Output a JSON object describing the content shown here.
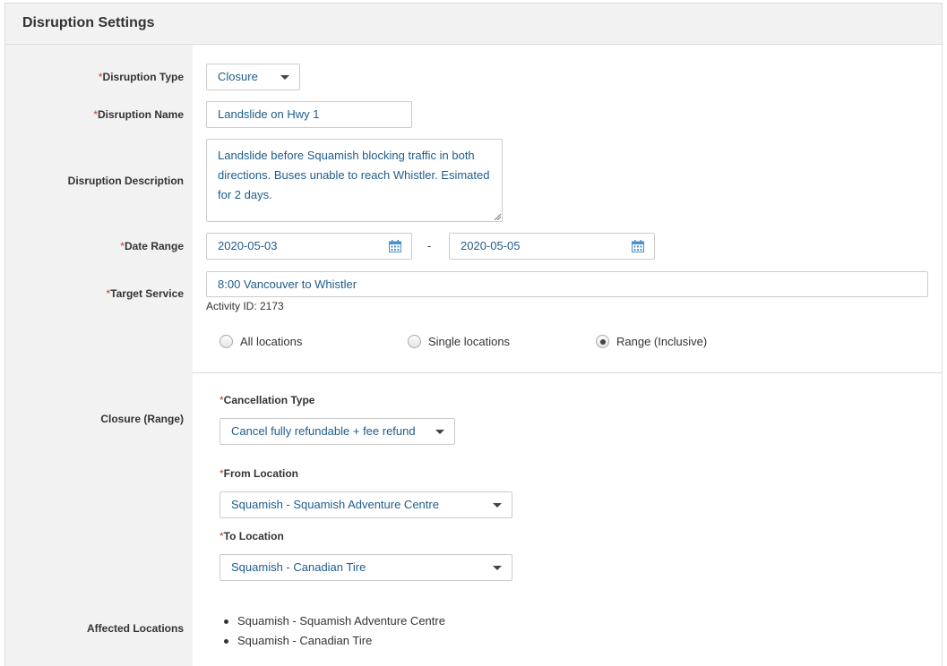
{
  "panel": {
    "title": "Disruption Settings"
  },
  "required_mark": "*",
  "form": {
    "disruption_type": {
      "label": "Disruption Type",
      "value": "Closure"
    },
    "disruption_name": {
      "label": "Disruption Name",
      "value": "Landslide on Hwy 1"
    },
    "disruption_description": {
      "label": "Disruption Description",
      "value": "Landslide before Squamish blocking traffic in both directions. Buses unable to reach Whistler. Esimated for 2 days."
    },
    "date_range": {
      "label": "Date Range",
      "start": "2020-05-03",
      "separator": "-",
      "end": "2020-05-05"
    },
    "target_service": {
      "label": "Target Service",
      "value": "8:00 Vancouver to Whistler",
      "activity_id": "Activity ID: 2173"
    },
    "location_scope": {
      "options": [
        {
          "label": "All locations",
          "selected": false
        },
        {
          "label": "Single locations",
          "selected": false
        },
        {
          "label": "Range (Inclusive)",
          "selected": true
        }
      ]
    }
  },
  "closure": {
    "section_label": "Closure (Range)",
    "cancellation_type": {
      "label": "Cancellation Type",
      "value": "Cancel fully refundable + fee refund"
    },
    "from_location": {
      "label": "From Location",
      "value": "Squamish - Squamish Adventure Centre"
    },
    "to_location": {
      "label": "To Location",
      "value": "Squamish - Canadian Tire"
    },
    "affected_locations": {
      "label": "Affected Locations",
      "items": [
        "Squamish - Squamish Adventure Centre",
        "Squamish - Canadian Tire"
      ]
    }
  },
  "colors": {
    "required": "#c0392b",
    "value_text": "#1f5c8b",
    "label_bg": "#f2f2f2"
  }
}
